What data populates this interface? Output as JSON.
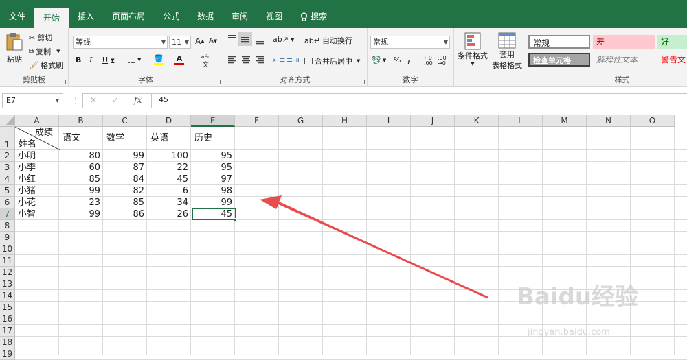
{
  "tabs": [
    "文件",
    "开始",
    "插入",
    "页面布局",
    "公式",
    "数据",
    "审阅",
    "视图",
    "搜索"
  ],
  "ribbon": {
    "clipboard": {
      "paste": "粘贴",
      "cut": "剪切",
      "copy": "复制",
      "format_painter": "格式刷",
      "label": "剪贴板"
    },
    "font": {
      "name": "等线",
      "size": "11",
      "bold": "B",
      "italic": "I",
      "underline": "U",
      "label": "字体",
      "phonetic": "wén"
    },
    "alignment": {
      "wrap": "自动换行",
      "merge": "合并后居中",
      "label": "对齐方式"
    },
    "number": {
      "format": "常规",
      "percent": "%",
      "comma": ",",
      "label": "数字"
    },
    "styles": {
      "conditional": "条件格式",
      "table_format_1": "套用",
      "table_format_2": "表格格式",
      "normal": "常规",
      "bad": "差",
      "good": "好",
      "check": "检查单元格",
      "explanatory": "解释性文本",
      "warning": "警告文",
      "label": "样式"
    }
  },
  "formula_bar": {
    "name_box": "E7",
    "cancel": "✕",
    "enter": "✓",
    "fx": "fx",
    "value": "45"
  },
  "columns": [
    "A",
    "B",
    "C",
    "D",
    "E",
    "F",
    "G",
    "H",
    "I",
    "J",
    "K",
    "L",
    "M",
    "N",
    "O"
  ],
  "selected_cell": "E7",
  "header_row": {
    "a_top": "成绩",
    "a_bottom": "姓名",
    "b": "语文",
    "c": "数学",
    "d": "英语",
    "e": "历史"
  },
  "rows": [
    {
      "name": "小明",
      "b": "80",
      "c": "99",
      "d": "100",
      "e": "95"
    },
    {
      "name": "小李",
      "b": "60",
      "c": "87",
      "d": "22",
      "e": "95"
    },
    {
      "name": "小红",
      "b": "85",
      "c": "84",
      "d": "45",
      "e": "97"
    },
    {
      "name": "小猪",
      "b": "99",
      "c": "82",
      "d": "6",
      "e": "98"
    },
    {
      "name": "小花",
      "b": "23",
      "c": "85",
      "d": "34",
      "e": "99"
    },
    {
      "name": "小智",
      "b": "99",
      "c": "86",
      "d": "26",
      "e": "45"
    }
  ],
  "row_numbers": [
    "1",
    "2",
    "3",
    "4",
    "5",
    "6",
    "7",
    "8",
    "9",
    "10",
    "11",
    "12",
    "13",
    "14",
    "15",
    "16",
    "17",
    "18",
    "19"
  ],
  "colors": {
    "brand": "#217346",
    "arrow": "#e84c4c",
    "bad_bg": "#ffc7ce",
    "good_bg": "#c6efce",
    "bad_text": "#9c0006",
    "warning_text": "#ff0000"
  },
  "watermark": {
    "brand": "Baidu经验",
    "url": "jingyan.baidu.com"
  }
}
